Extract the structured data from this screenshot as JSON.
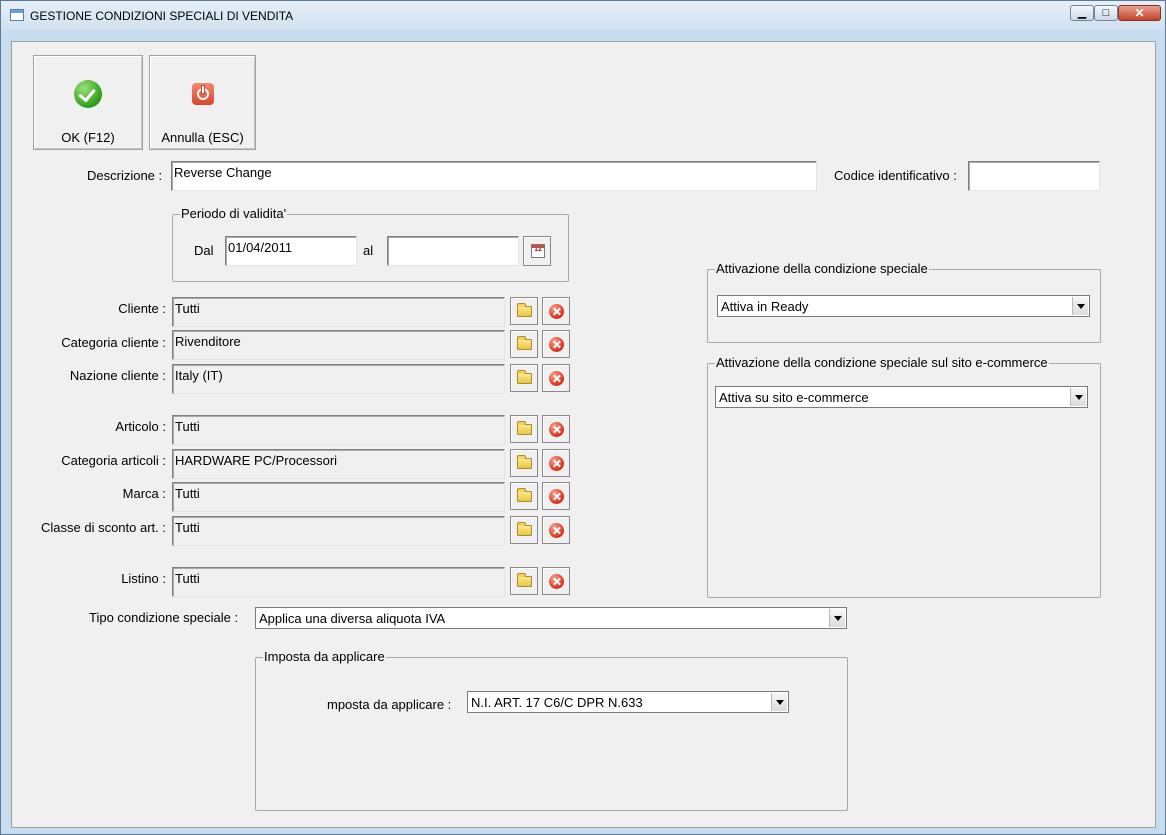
{
  "window": {
    "title": "GESTIONE CONDIZIONI SPECIALI DI VENDITA"
  },
  "toolbar": {
    "ok_label": "OK (F12)",
    "cancel_label": "Annulla (ESC)"
  },
  "form": {
    "descrizione_label": "Descrizione :",
    "descrizione_value": "Reverse Change",
    "codice_label": "Codice identificativo :",
    "codice_value": "",
    "periodo": {
      "title": "Periodo di validita'",
      "dal_label": "Dal",
      "dal_value": "01/04/2011",
      "al_label": "al",
      "al_value": ""
    },
    "filters": [
      {
        "label": "Cliente :",
        "value": "Tutti"
      },
      {
        "label": "Categoria cliente :",
        "value": "Rivenditore"
      },
      {
        "label": "Nazione cliente :",
        "value": "Italy (IT)"
      },
      {
        "label": "Articolo :",
        "value": "Tutti"
      },
      {
        "label": "Categoria articoli :",
        "value": "HARDWARE PC/Processori"
      },
      {
        "label": "Marca :",
        "value": "Tutti"
      },
      {
        "label": "Classe di sconto art. :",
        "value": "Tutti"
      },
      {
        "label": "Listino :",
        "value": "Tutti"
      }
    ],
    "tipo_label": "Tipo condizione speciale :",
    "tipo_value": "Applica una diversa aliquota IVA",
    "imposta": {
      "title": "Imposta da applicare",
      "label": "mposta da applicare :",
      "value": "N.I. ART. 17 C6/C DPR N.633"
    }
  },
  "attivazione": {
    "title": "Attivazione della condizione speciale",
    "value": "Attiva in Ready"
  },
  "attivazione_ecom": {
    "title": "Attivazione della condizione speciale sul sito e-commerce",
    "value": "Attiva su sito e-commerce"
  },
  "icons": {
    "calendar_text": "12"
  },
  "colors": {
    "titlebar": "#cfe0f0",
    "panel": "#f0f0f0",
    "close_button": "#c4432b"
  }
}
